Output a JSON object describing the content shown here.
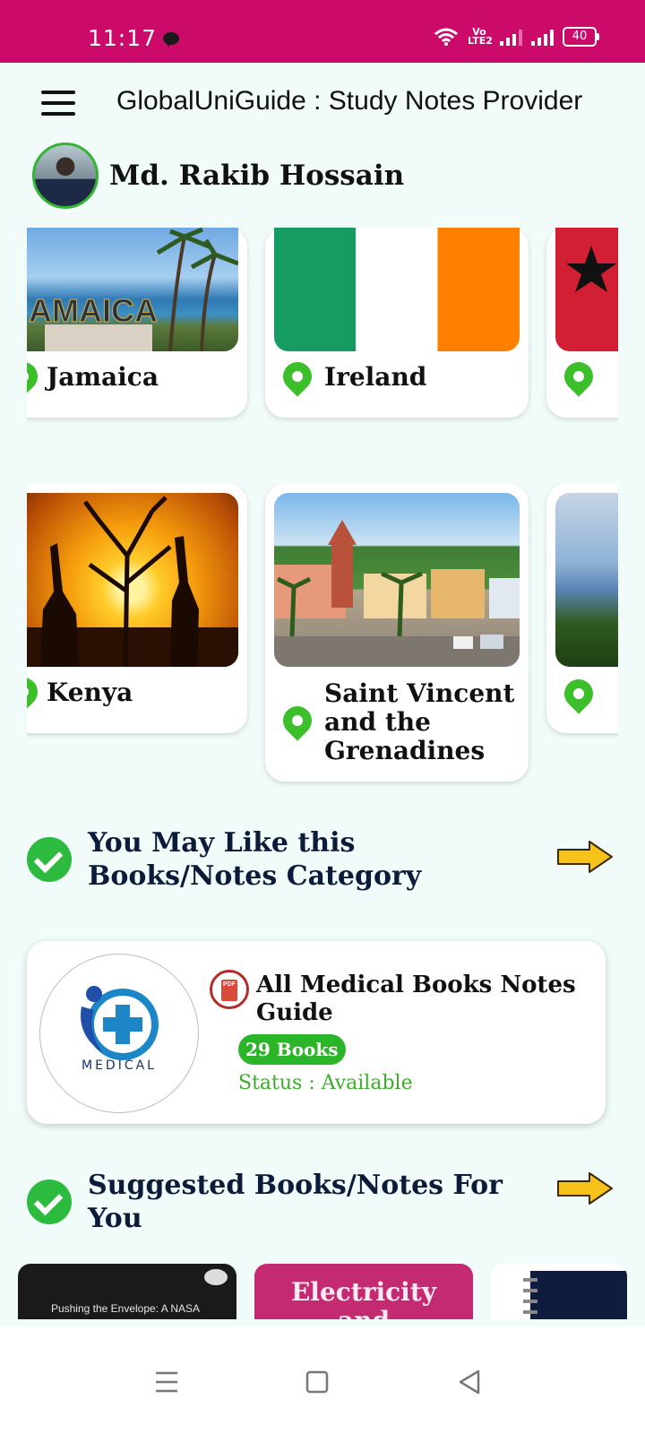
{
  "status_bar": {
    "time": "11:17",
    "volte": "Vo LTE2",
    "battery": "40"
  },
  "app_bar": {
    "title": "GlobalUniGuide : Study Notes Provider",
    "menu_icon": "hamburger-menu-icon"
  },
  "user": {
    "name": "Md. Rakib Hossain"
  },
  "countries_row1": [
    {
      "name": "Jamaica"
    },
    {
      "name": "Ireland"
    },
    {
      "name": ""
    }
  ],
  "countries_row2": [
    {
      "name": "Kenya"
    },
    {
      "name": "Saint Vincent and the Grenadines"
    },
    {
      "name": ""
    }
  ],
  "section_category": {
    "title": "You May Like this Books/Notes Category"
  },
  "category_card": {
    "logo_text": "MEDICAL",
    "pdf_label": "PDF",
    "title": "All Medical Books Notes Guide",
    "books_count": "29 Books",
    "status": "Status : Available"
  },
  "section_suggested": {
    "title": "Suggested Books/Notes For You"
  },
  "suggested_books": [
    {
      "title": "Pushing the Envelope: A NASA Guide to Engines"
    },
    {
      "title": "Electricity and"
    }
  ],
  "colors": {
    "status_bar": "#cc0a6a",
    "accent_green": "#2db52a",
    "background": "#f1fbfa",
    "arrow": "#f7c21a"
  }
}
